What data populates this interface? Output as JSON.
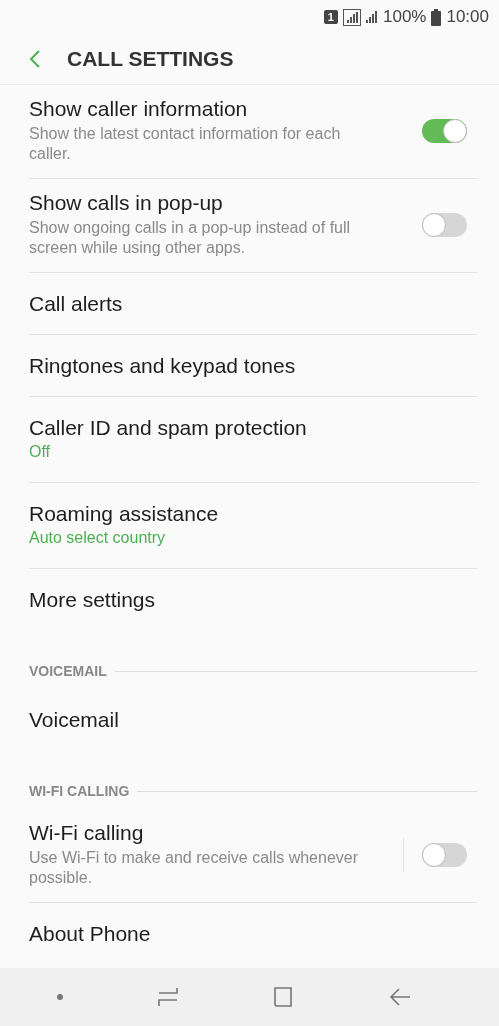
{
  "status_bar": {
    "sim": "1",
    "battery": "100%",
    "time": "10:00"
  },
  "header": {
    "title": "CALL SETTINGS"
  },
  "items": [
    {
      "kind": "toggle",
      "title": "Show caller information",
      "subtitle": "Show the latest contact information for each caller.",
      "on": true,
      "separated": false
    },
    {
      "kind": "toggle",
      "title": "Show calls in pop-up",
      "subtitle": "Show ongoing calls in a pop-up instead of full screen while using other apps.",
      "on": false,
      "separated": false
    },
    {
      "kind": "plain",
      "title": "Call alerts"
    },
    {
      "kind": "plain",
      "title": "Ringtones and keypad tones"
    },
    {
      "kind": "value",
      "title": "Caller ID and spam protection",
      "value": "Off"
    },
    {
      "kind": "value",
      "title": "Roaming assistance",
      "value": "Auto select country"
    },
    {
      "kind": "plain",
      "title": "More settings"
    },
    {
      "kind": "section",
      "title": "VOICEMAIL"
    },
    {
      "kind": "plain",
      "title": "Voicemail"
    },
    {
      "kind": "section",
      "title": "WI-FI CALLING"
    },
    {
      "kind": "toggle",
      "title": "Wi-Fi calling",
      "subtitle": "Use Wi-Fi to make and receive calls whenever possible.",
      "on": false,
      "separated": true
    },
    {
      "kind": "plain",
      "title": "About Phone"
    }
  ]
}
